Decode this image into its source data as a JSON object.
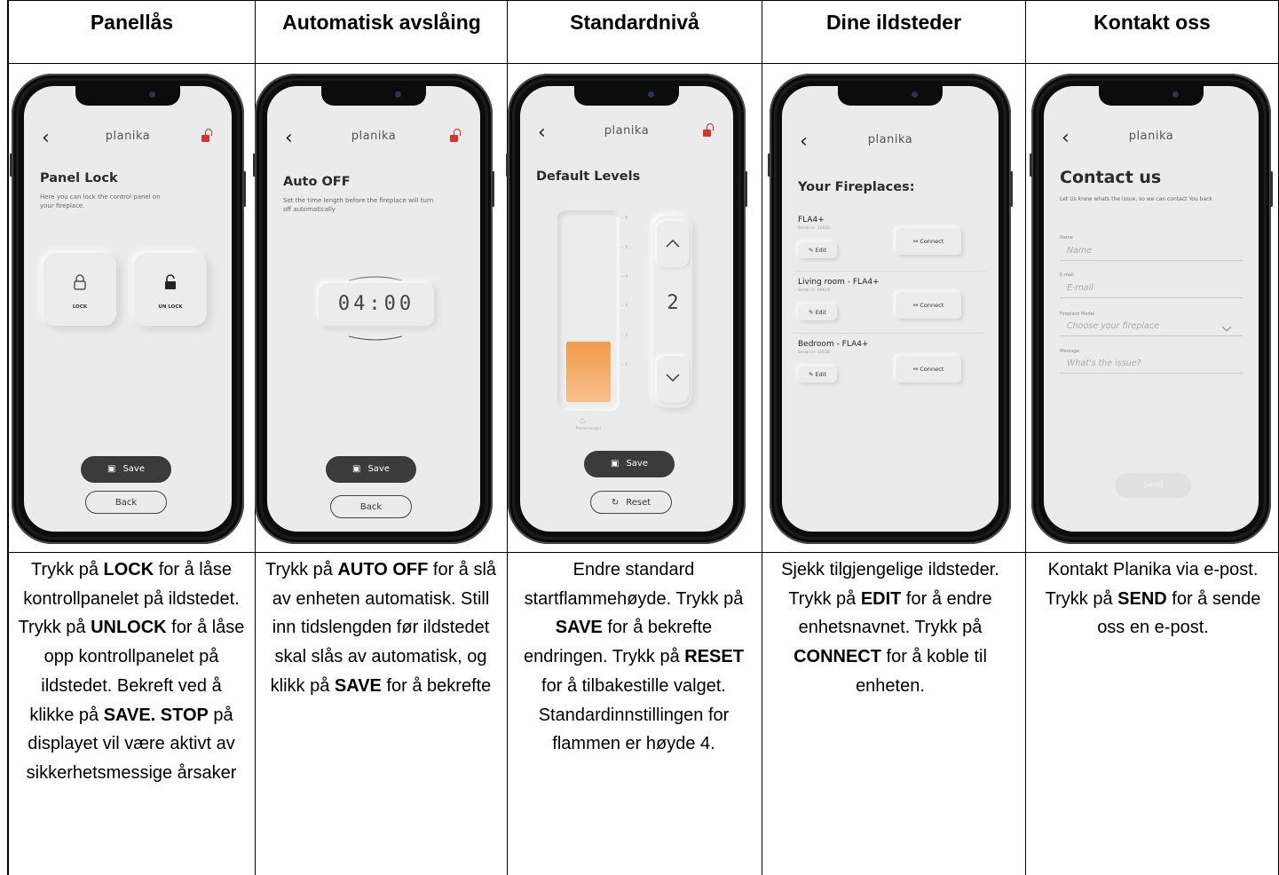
{
  "columns": [
    {
      "header": "Panellås",
      "description_html": "Trykk på <b>LOCK</b> for å låse kontrollpanelet på ildstedet. Trykk på <b>UNLOCK</b> for å låse opp kontrollpanelet på ildstedet. Bekreft ved å klikke på <b>SAVE. STOP</b> på displayet vil være aktivt av sikkerhetsmessige årsaker",
      "screen": {
        "brand": "planika",
        "title": "Panel Lock",
        "subtitle": "Here you can lock the control panel on your fireplace.",
        "lock_label": "LOCK",
        "unlock_label": "UN LOCK",
        "save_label": "Save",
        "back_label": "Back"
      }
    },
    {
      "header": "Automatisk avslåing",
      "description_html": "Trykk på <b>AUTO OFF</b> for å slå av enheten automatisk. Still inn tidslengden før ildstedet skal slås av automatisk, og klikk på <b>SAVE</b> for å bekrefte",
      "screen": {
        "brand": "planika",
        "title": "Auto OFF",
        "subtitle": "Set the time length before the fireplace will turn off automatically",
        "time": "04:00",
        "save_label": "Save",
        "back_label": "Back"
      }
    },
    {
      "header": "Standardnivå",
      "description_html": "Endre standard startflammehøyde. Trykk på <b>SAVE</b> for å bekrefte endringen. Trykk på <b>RESET</b> for å tilbakestille valget. Standardinnstillingen for flammen er høyde 4.",
      "screen": {
        "brand": "planika",
        "title": "Default Levels",
        "level": "2",
        "level_fraction": 0.33,
        "scale_ticks": [
          "6",
          "5",
          "4",
          "3",
          "2",
          "1"
        ],
        "gauge_label": "flame height",
        "save_label": "Save",
        "reset_label": "Reset"
      }
    },
    {
      "header": "Dine ildsteder",
      "description_html": "Sjekk tilgjengelige ildsteder. Trykk på <b>EDIT</b> for å endre enhetsnavnet. Trykk på <b>CONNECT</b> for å koble til enheten.",
      "screen": {
        "brand": "planika",
        "title": "Your Fireplaces:",
        "fireplaces": [
          {
            "name": "FLA4+",
            "serial": "Serial nr: 10010"
          },
          {
            "name": "Living room - FLA4+",
            "serial": "Serial nr: 09614"
          },
          {
            "name": "Bedroom - FLA4+",
            "serial": "Serial nr: 10138"
          }
        ],
        "edit_label": "Edit",
        "connect_label": "Connect"
      }
    },
    {
      "header": "Kontakt oss",
      "description_html": "Kontakt Planika via e-post. Trykk på <b>SEND</b> for å sende oss en e-post.",
      "screen": {
        "brand": "planika",
        "title": "Contact us",
        "subtitle": "Let Us know whats the issue, so we can contact You back",
        "name_label": "Name",
        "name_placeholder": "Name",
        "email_label": "E-mail",
        "email_placeholder": "E-mail",
        "model_label": "Fireplace Model",
        "model_placeholder": "Choose your fireplace",
        "message_label": "Message",
        "message_placeholder": "What's the issue?",
        "send_label": "Send"
      }
    }
  ],
  "colors": {
    "accent_orange": "#f0a25a",
    "lock_red": "#d9342b",
    "button_dark": "#3b3b3b",
    "screen_bg": "#ebebeb"
  }
}
